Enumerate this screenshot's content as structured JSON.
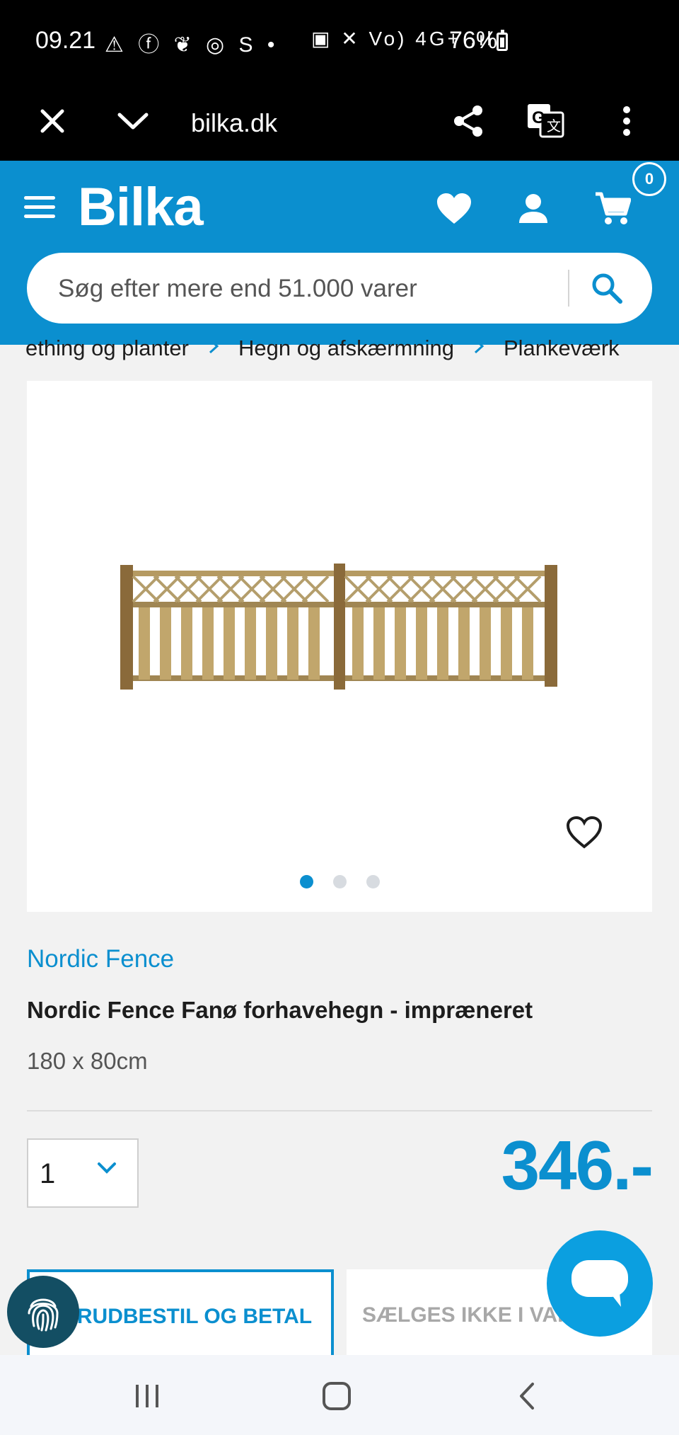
{
  "status_bar": {
    "time": "09.21",
    "left_icons": "⚠ ⓕ ❦ ◎ S •",
    "right_icons": "▣ ✕ Vo) 4G+ .ıl",
    "battery": "76%"
  },
  "browser": {
    "url": "bilka.dk",
    "icons": [
      "close-icon",
      "chevron-down-icon",
      "share-icon",
      "translate-icon",
      "more-icon"
    ]
  },
  "header": {
    "logo": "Bilka",
    "cart_count": "0",
    "search_placeholder": "Søg efter mere end 51.000 varer"
  },
  "breadcrumb": {
    "items": [
      "ething og planter",
      "Hegn og afskærmning",
      "Plankeværk"
    ]
  },
  "product": {
    "brand": "Nordic Fence",
    "title": "Nordic Fence Fanø forhavehegn - impræneret",
    "size": "180 x 80cm",
    "quantity": "1",
    "price": "346.-",
    "image_count": 3,
    "active_image": 1
  },
  "actions": {
    "primary_label": "RUDBESTIL OG BETAL",
    "secondary_label": "SÆLGES IKKE I VAR"
  },
  "colors": {
    "brand_blue": "#0b8fcf",
    "chat_blue": "#0b9fe0",
    "fingerprint_bg": "#134e63"
  }
}
